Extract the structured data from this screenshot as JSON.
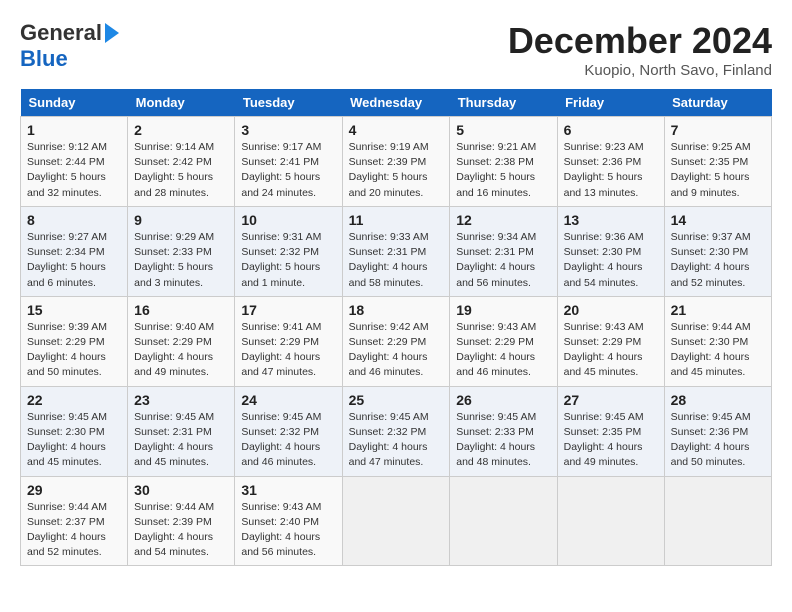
{
  "header": {
    "logo_line1": "General",
    "logo_line2": "Blue",
    "month": "December 2024",
    "location": "Kuopio, North Savo, Finland"
  },
  "days_of_week": [
    "Sunday",
    "Monday",
    "Tuesday",
    "Wednesday",
    "Thursday",
    "Friday",
    "Saturday"
  ],
  "weeks": [
    [
      {
        "num": "1",
        "sunrise": "9:12 AM",
        "sunset": "2:44 PM",
        "daylight": "5 hours and 32 minutes."
      },
      {
        "num": "2",
        "sunrise": "9:14 AM",
        "sunset": "2:42 PM",
        "daylight": "5 hours and 28 minutes."
      },
      {
        "num": "3",
        "sunrise": "9:17 AM",
        "sunset": "2:41 PM",
        "daylight": "5 hours and 24 minutes."
      },
      {
        "num": "4",
        "sunrise": "9:19 AM",
        "sunset": "2:39 PM",
        "daylight": "5 hours and 20 minutes."
      },
      {
        "num": "5",
        "sunrise": "9:21 AM",
        "sunset": "2:38 PM",
        "daylight": "5 hours and 16 minutes."
      },
      {
        "num": "6",
        "sunrise": "9:23 AM",
        "sunset": "2:36 PM",
        "daylight": "5 hours and 13 minutes."
      },
      {
        "num": "7",
        "sunrise": "9:25 AM",
        "sunset": "2:35 PM",
        "daylight": "5 hours and 9 minutes."
      }
    ],
    [
      {
        "num": "8",
        "sunrise": "9:27 AM",
        "sunset": "2:34 PM",
        "daylight": "5 hours and 6 minutes."
      },
      {
        "num": "9",
        "sunrise": "9:29 AM",
        "sunset": "2:33 PM",
        "daylight": "5 hours and 3 minutes."
      },
      {
        "num": "10",
        "sunrise": "9:31 AM",
        "sunset": "2:32 PM",
        "daylight": "5 hours and 1 minute."
      },
      {
        "num": "11",
        "sunrise": "9:33 AM",
        "sunset": "2:31 PM",
        "daylight": "4 hours and 58 minutes."
      },
      {
        "num": "12",
        "sunrise": "9:34 AM",
        "sunset": "2:31 PM",
        "daylight": "4 hours and 56 minutes."
      },
      {
        "num": "13",
        "sunrise": "9:36 AM",
        "sunset": "2:30 PM",
        "daylight": "4 hours and 54 minutes."
      },
      {
        "num": "14",
        "sunrise": "9:37 AM",
        "sunset": "2:30 PM",
        "daylight": "4 hours and 52 minutes."
      }
    ],
    [
      {
        "num": "15",
        "sunrise": "9:39 AM",
        "sunset": "2:29 PM",
        "daylight": "4 hours and 50 minutes."
      },
      {
        "num": "16",
        "sunrise": "9:40 AM",
        "sunset": "2:29 PM",
        "daylight": "4 hours and 49 minutes."
      },
      {
        "num": "17",
        "sunrise": "9:41 AM",
        "sunset": "2:29 PM",
        "daylight": "4 hours and 47 minutes."
      },
      {
        "num": "18",
        "sunrise": "9:42 AM",
        "sunset": "2:29 PM",
        "daylight": "4 hours and 46 minutes."
      },
      {
        "num": "19",
        "sunrise": "9:43 AM",
        "sunset": "2:29 PM",
        "daylight": "4 hours and 46 minutes."
      },
      {
        "num": "20",
        "sunrise": "9:43 AM",
        "sunset": "2:29 PM",
        "daylight": "4 hours and 45 minutes."
      },
      {
        "num": "21",
        "sunrise": "9:44 AM",
        "sunset": "2:30 PM",
        "daylight": "4 hours and 45 minutes."
      }
    ],
    [
      {
        "num": "22",
        "sunrise": "9:45 AM",
        "sunset": "2:30 PM",
        "daylight": "4 hours and 45 minutes."
      },
      {
        "num": "23",
        "sunrise": "9:45 AM",
        "sunset": "2:31 PM",
        "daylight": "4 hours and 45 minutes."
      },
      {
        "num": "24",
        "sunrise": "9:45 AM",
        "sunset": "2:32 PM",
        "daylight": "4 hours and 46 minutes."
      },
      {
        "num": "25",
        "sunrise": "9:45 AM",
        "sunset": "2:32 PM",
        "daylight": "4 hours and 47 minutes."
      },
      {
        "num": "26",
        "sunrise": "9:45 AM",
        "sunset": "2:33 PM",
        "daylight": "4 hours and 48 minutes."
      },
      {
        "num": "27",
        "sunrise": "9:45 AM",
        "sunset": "2:35 PM",
        "daylight": "4 hours and 49 minutes."
      },
      {
        "num": "28",
        "sunrise": "9:45 AM",
        "sunset": "2:36 PM",
        "daylight": "4 hours and 50 minutes."
      }
    ],
    [
      {
        "num": "29",
        "sunrise": "9:44 AM",
        "sunset": "2:37 PM",
        "daylight": "4 hours and 52 minutes."
      },
      {
        "num": "30",
        "sunrise": "9:44 AM",
        "sunset": "2:39 PM",
        "daylight": "4 hours and 54 minutes."
      },
      {
        "num": "31",
        "sunrise": "9:43 AM",
        "sunset": "2:40 PM",
        "daylight": "4 hours and 56 minutes."
      },
      null,
      null,
      null,
      null
    ]
  ]
}
